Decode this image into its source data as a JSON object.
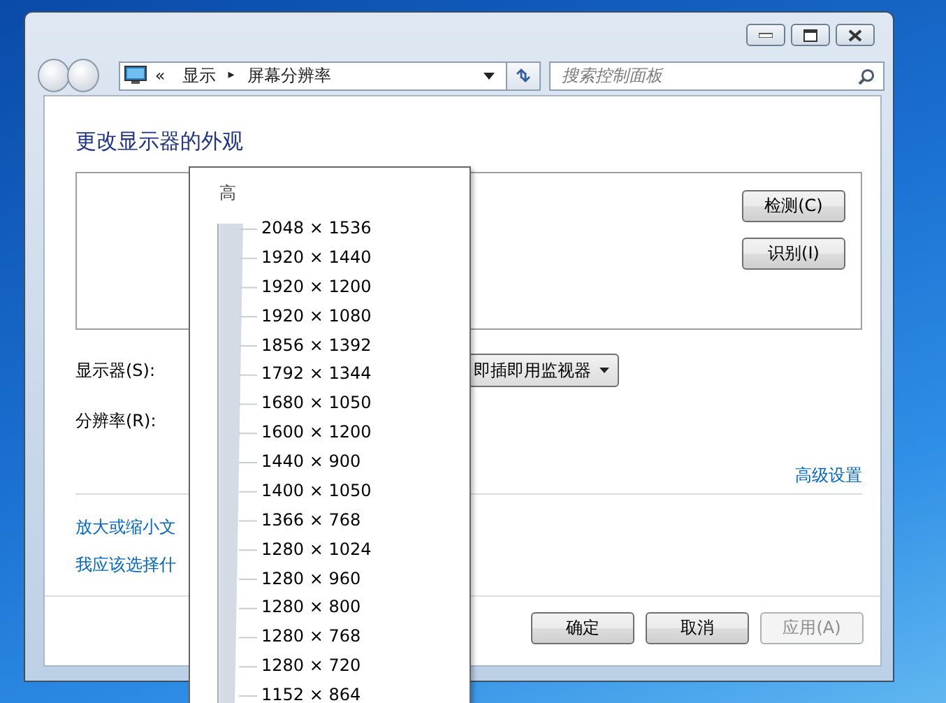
{
  "address_bar": {
    "prefix": "«",
    "breadcrumb": [
      "显示",
      "屏幕分辨率"
    ],
    "separator": "▸"
  },
  "search": {
    "placeholder": "搜索控制面板"
  },
  "heading": "更改显示器的外观",
  "monitor_buttons": [
    "检测(C)",
    "识别(I)"
  ],
  "display": {
    "label": "显示器(S):",
    "value": "即插即用监视器"
  },
  "resolution": {
    "label": "分辨率(R):"
  },
  "advanced_link": "高级设置",
  "links": [
    "放大或缩小文",
    "我应该选择什"
  ],
  "dialog_buttons": [
    {
      "label": "确定",
      "disabled": false
    },
    {
      "label": "取消",
      "disabled": false
    },
    {
      "label": "应用(A)",
      "disabled": true
    }
  ],
  "resolution_popup": {
    "top_label": "高",
    "options": [
      "2048 × 1536",
      "1920 × 1440",
      "1920 × 1200",
      "1920 × 1080",
      "1856 × 1392",
      "1792 × 1344",
      "1680 × 1050",
      "1600 × 1200",
      "1440 × 900",
      "1400 × 1050",
      "1366 × 768",
      "1280 × 1024",
      "1280 × 960",
      "1280 × 800",
      "1280 × 768",
      "1280 × 720",
      "1152 × 864"
    ]
  }
}
